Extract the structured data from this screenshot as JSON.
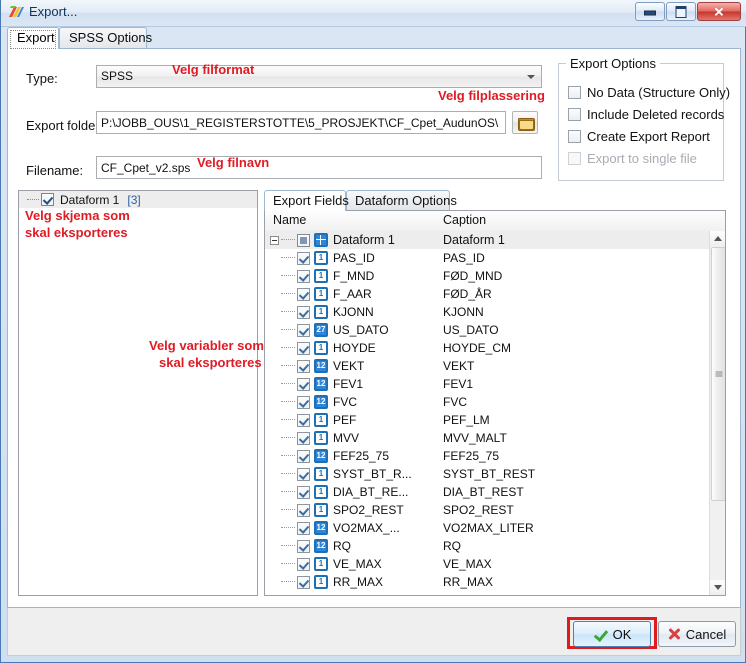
{
  "window": {
    "title": "Export...",
    "icon": "export-app-icon",
    "controls": {
      "minimize": "minimize",
      "maximize": "maximize",
      "close": "close"
    }
  },
  "tabs": [
    {
      "id": "export",
      "label": "Export",
      "active": true
    },
    {
      "id": "spss_options",
      "label": "SPSS Options",
      "active": false
    }
  ],
  "form": {
    "type_label": "Type:",
    "type_value": "SPSS",
    "export_folder_label": "Export folder:",
    "export_folder_value": "P:\\JOBB_OUS\\1_REGISTERSTOTTE\\5_PROSJEKT\\CF_Cpet_AudunOS\\",
    "browse_icon": "folder-icon",
    "filename_label": "Filename:",
    "filename_value": "CF_Cpet_v2.sps"
  },
  "export_options": {
    "title": "Export Options",
    "items": [
      {
        "label": "No Data (Structure Only)",
        "checked": false,
        "disabled": false
      },
      {
        "label": "Include Deleted records",
        "checked": false,
        "disabled": false
      },
      {
        "label": "Create Export Report",
        "checked": false,
        "disabled": false
      },
      {
        "label": "Export to single file",
        "checked": false,
        "disabled": true
      }
    ]
  },
  "dataform_tree": {
    "row_label": "Dataform 1",
    "row_count": "[3]",
    "checked": true
  },
  "right_tabs": [
    {
      "id": "export_fields",
      "label": "Export Fields",
      "active": true
    },
    {
      "id": "dataform_options",
      "label": "Dataform Options",
      "active": false
    }
  ],
  "grid": {
    "columns": [
      "Name",
      "Caption"
    ],
    "root": {
      "name": "Dataform 1",
      "caption": "Dataform 1",
      "icon": "dataform-grid-icon",
      "check": "filled"
    },
    "rows": [
      {
        "name": "PAS_ID",
        "caption": "PAS_ID",
        "icon": "integer-field-icon",
        "checked": true
      },
      {
        "name": "F_MND",
        "caption": "FØD_MND",
        "icon": "integer-field-icon",
        "checked": true
      },
      {
        "name": "F_AAR",
        "caption": "FØD_ÅR",
        "icon": "integer-field-icon",
        "checked": true
      },
      {
        "name": "KJONN",
        "caption": "KJONN",
        "icon": "integer-field-icon",
        "checked": true
      },
      {
        "name": "US_DATO",
        "caption": "US_DATO",
        "icon": "date-field-icon",
        "checked": true
      },
      {
        "name": "HOYDE",
        "caption": "HOYDE_CM",
        "icon": "integer-field-icon",
        "checked": true
      },
      {
        "name": "VEKT",
        "caption": "VEKT",
        "icon": "decimal-field-icon",
        "checked": true
      },
      {
        "name": "FEV1",
        "caption": "FEV1",
        "icon": "decimal-field-icon",
        "checked": true
      },
      {
        "name": "FVC",
        "caption": "FVC",
        "icon": "decimal-field-icon",
        "checked": true
      },
      {
        "name": "PEF",
        "caption": "PEF_LM",
        "icon": "integer-field-icon",
        "checked": true
      },
      {
        "name": "MVV",
        "caption": "MVV_MALT",
        "icon": "integer-field-icon",
        "checked": true
      },
      {
        "name": "FEF25_75",
        "caption": "FEF25_75",
        "icon": "decimal-field-icon",
        "checked": true
      },
      {
        "name": "SYST_BT_R...",
        "caption": "SYST_BT_REST",
        "icon": "integer-field-icon",
        "checked": true
      },
      {
        "name": "DIA_BT_RE...",
        "caption": "DIA_BT_REST",
        "icon": "integer-field-icon",
        "checked": true
      },
      {
        "name": "SPO2_REST",
        "caption": "SPO2_REST",
        "icon": "integer-field-icon",
        "checked": true
      },
      {
        "name": "VO2MAX_...",
        "caption": "VO2MAX_LITER",
        "icon": "decimal-field-icon",
        "checked": true
      },
      {
        "name": "RQ",
        "caption": "RQ",
        "icon": "decimal-field-icon",
        "checked": true
      },
      {
        "name": "VE_MAX",
        "caption": "VE_MAX",
        "icon": "integer-field-icon",
        "checked": true
      },
      {
        "name": "RR_MAX",
        "caption": "RR_MAX",
        "icon": "integer-field-icon",
        "checked": true
      }
    ],
    "icon_glyphs": {
      "integer-field-icon": "1",
      "decimal-field-icon": "12",
      "date-field-icon": "27"
    }
  },
  "footer": {
    "ok_label": "OK",
    "cancel_label": "Cancel",
    "ok_icon": "green-check-icon",
    "cancel_icon": "red-x-icon"
  },
  "annotations": [
    {
      "id": "type",
      "text": "Velg filformat"
    },
    {
      "id": "folder",
      "text": "Velg filplassering"
    },
    {
      "id": "filename",
      "text": "Velg filnavn"
    },
    {
      "id": "form1",
      "text": "Velg skjema som"
    },
    {
      "id": "form2",
      "text": "skal eksporteres"
    },
    {
      "id": "vars1",
      "text": "Velg variabler som"
    },
    {
      "id": "vars2",
      "text": "skal eksporteres"
    }
  ],
  "colors": {
    "annotation": "#e01b24",
    "highlight_box": "#e01b1b",
    "tree_count": "#2d5fa6",
    "field_icon": "#2e86d8"
  }
}
